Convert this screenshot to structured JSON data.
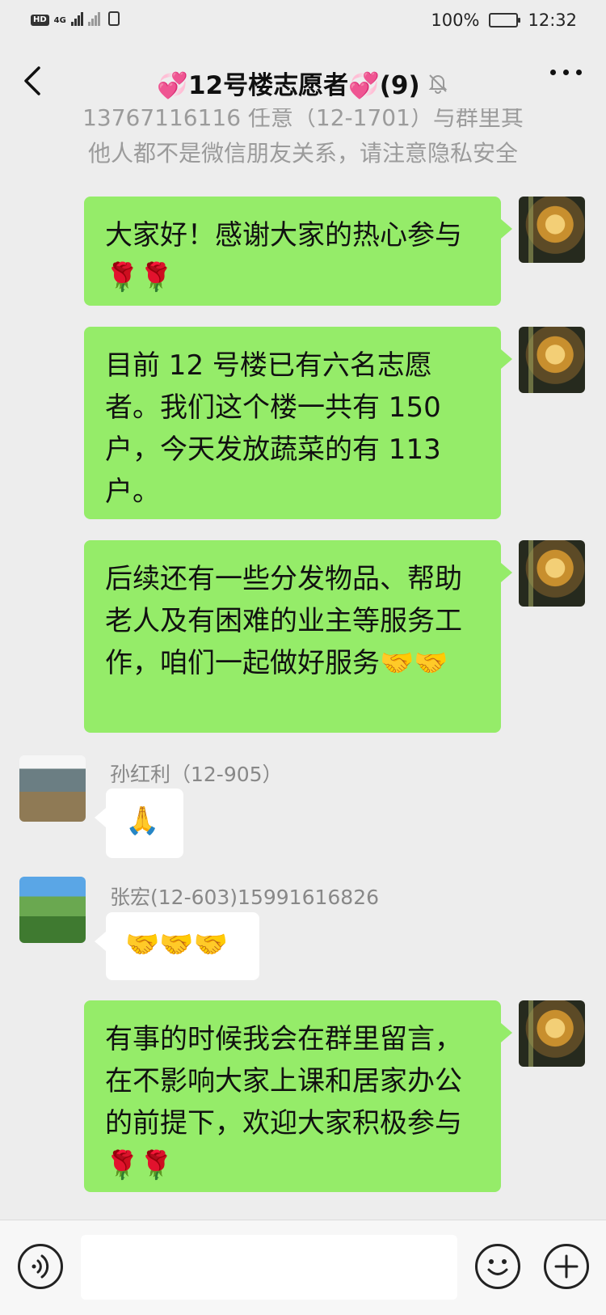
{
  "status_bar": {
    "hd": "HD",
    "network": "4G",
    "battery": "100%",
    "time": "12:32"
  },
  "header": {
    "title": "💞12号楼志愿者💞(9)",
    "muted": true
  },
  "notice": {
    "line1": "13767116116 任意（12-1701）与群里其",
    "line2": "他人都不是微信朋友关系，请注意隐私安全"
  },
  "messages": [
    {
      "side": "right",
      "text": "大家好！感谢大家的热心参与🌹🌹"
    },
    {
      "side": "right",
      "text": "目前 12 号楼已有六名志愿者。我们这个楼一共有 150 户，今天发放蔬菜的有 113 户。"
    },
    {
      "side": "right",
      "text": "后续还有一些分发物品、帮助老人及有困难的业主等服务工作，咱们一起做好服务🤝🤝"
    },
    {
      "side": "left",
      "sender": "孙红利（12-905）",
      "text": "🙏"
    },
    {
      "side": "left",
      "sender": "张宏(12-603)15991616826",
      "text": "🤝🤝🤝"
    },
    {
      "side": "right",
      "text": "有事的时候我会在群里留言，在不影响大家上课和居家办公的前提下，欢迎大家积极参与🌹🌹"
    }
  ],
  "composer": {
    "input_value": "",
    "input_placeholder": ""
  },
  "colors": {
    "background": "#ededed",
    "bubble_self": "#95ec69",
    "bubble_other": "#ffffff",
    "secondary_text": "#9b9b9b"
  }
}
